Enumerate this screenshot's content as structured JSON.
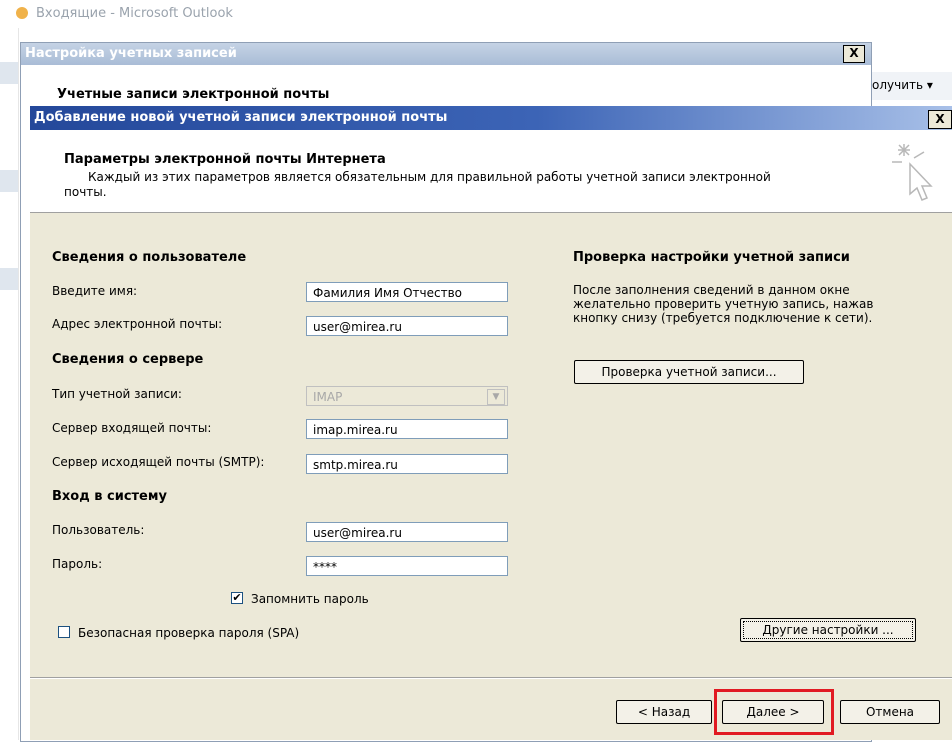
{
  "outlook": {
    "window_title": "Входящие - Microsoft Outlook",
    "receive_button": "олучить ▾"
  },
  "account_settings": {
    "title": "Настройка учетных записей",
    "close": "X",
    "heading": "Учетные записи электронной почты"
  },
  "add_account": {
    "title": "Добавление новой учетной записи электронной почты",
    "close": "X",
    "header_title": "Параметры электронной почты Интернета",
    "header_desc_line1": "Каждый из этих параметров является обязательным для правильной работы учетной записи электронной",
    "header_desc_line2": "почты."
  },
  "user_info": {
    "heading": "Сведения о пользователе",
    "name_label": "Введите имя:",
    "name_value": "Фамилия Имя Отчество",
    "email_label": "Адрес электронной почты:",
    "email_value": "user@mirea.ru"
  },
  "server_info": {
    "heading": "Сведения о сервере",
    "type_label": "Тип учетной записи:",
    "type_value": "IMAP",
    "incoming_label": "Сервер входящей почты:",
    "incoming_value": "imap.mirea.ru",
    "outgoing_label": "Сервер исходящей почты (SMTP):",
    "outgoing_value": "smtp.mirea.ru"
  },
  "logon": {
    "heading": "Вход в систему",
    "user_label": "Пользователь:",
    "user_value": "user@mirea.ru",
    "password_label": "Пароль:",
    "password_value": "****",
    "remember_label": "Запомнить пароль",
    "remember_checked": "✔",
    "spa_label": "Безопасная проверка пароля (SPA)"
  },
  "test": {
    "heading": "Проверка настройки учетной записи",
    "desc_line1": "После заполнения сведений в данном окне",
    "desc_line2": "желательно проверить учетную запись, нажав",
    "desc_line3": "кнопку снизу (требуется подключение к сети).",
    "button": "Проверка учетной записи..."
  },
  "buttons": {
    "other_settings": "Другие настройки ...",
    "back": "< Назад",
    "next": "Далее >",
    "cancel": "Отмена"
  },
  "colors": {
    "titlebar_active": "#24489a",
    "dialog_bg": "#ece9d8",
    "highlight": "#e11a22"
  }
}
